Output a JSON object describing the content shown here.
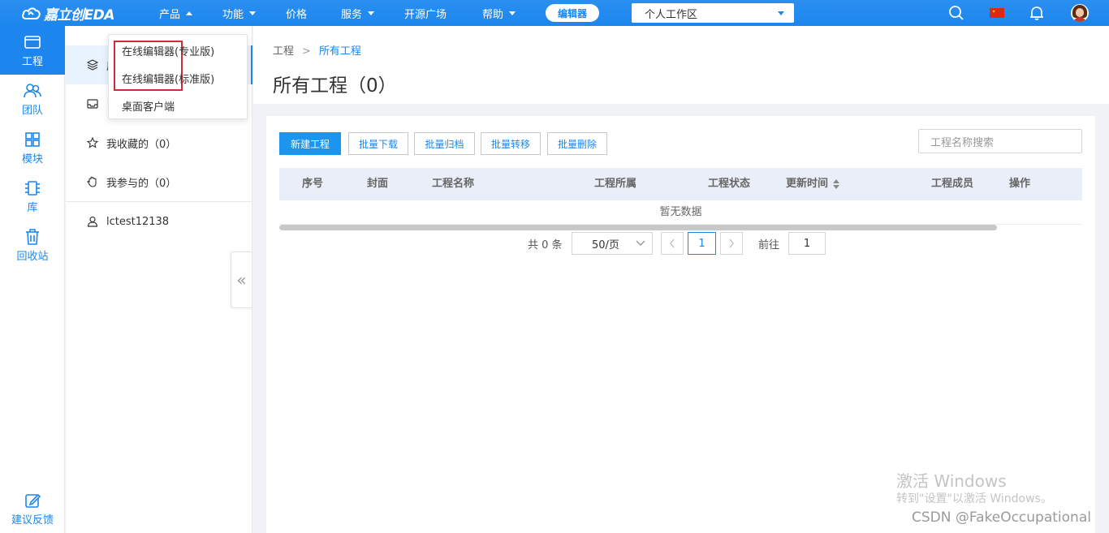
{
  "topbar": {
    "logo_text": "嘉立创EDA",
    "nav": [
      {
        "label": "产品",
        "caret": "up"
      },
      {
        "label": "功能",
        "caret": "down"
      },
      {
        "label": "价格",
        "caret": ""
      },
      {
        "label": "服务",
        "caret": "down"
      },
      {
        "label": "开源广场",
        "caret": ""
      },
      {
        "label": "帮助",
        "caret": "down"
      }
    ],
    "editor_button": "编辑器",
    "workspace_select": "个人工作区",
    "icons": [
      "search-icon",
      "language-flag-icon",
      "bell-icon",
      "avatar"
    ]
  },
  "rail": {
    "items": [
      {
        "label": "工程",
        "icon": "folder-icon",
        "active": true
      },
      {
        "label": "团队",
        "icon": "team-icon",
        "active": false
      },
      {
        "label": "模块",
        "icon": "grid-icon",
        "active": false
      },
      {
        "label": "库",
        "icon": "chip-icon",
        "active": false
      },
      {
        "label": "回收站",
        "icon": "trash-icon",
        "active": false
      }
    ],
    "feedback": "建议反馈"
  },
  "side": {
    "items": [
      {
        "label": "所有工程",
        "icon": "layers-icon",
        "visible_label": "原"
      },
      {
        "label": "!",
        "icon": "inbox-icon",
        "visible_label": "!"
      },
      {
        "label": "我收藏的（0）",
        "icon": "star-icon"
      },
      {
        "label": "我参与的（0）",
        "icon": "hand-icon"
      }
    ],
    "user": "lctest12138"
  },
  "dropdown": {
    "items": [
      {
        "main": "在线编辑器",
        "sub": "(专业版)"
      },
      {
        "main": "在线编辑器",
        "sub": "(标准版)"
      },
      {
        "main": "桌面客户端",
        "sub": ""
      }
    ]
  },
  "header": {
    "breadcrumb": [
      "工程",
      "所有工程"
    ],
    "breadcrumb_sep": ">",
    "title": "所有工程（0）"
  },
  "toolbar": {
    "new_project": "新建工程",
    "batch_download": "批量下载",
    "batch_archive": "批量归档",
    "batch_transfer": "批量转移",
    "batch_delete": "批量删除",
    "search_placeholder": "工程名称搜索"
  },
  "table": {
    "columns": [
      "序号",
      "封面",
      "工程名称",
      "工程所属",
      "工程状态",
      "更新时间",
      "工程成员",
      "操作"
    ],
    "empty_text": "暂无数据"
  },
  "pagination": {
    "total": "共 0 条",
    "page_size": "50/页",
    "current_page": "1",
    "goto_label": "前往",
    "goto_value": "1"
  },
  "watermark": {
    "line1": "激活 Windows",
    "line2": "转到\"设置\"以激活 Windows。",
    "csdn": "CSDN @FakeOccupational"
  },
  "colors": {
    "accent": "#1c86ee",
    "highlight_box": "#c9303b"
  }
}
